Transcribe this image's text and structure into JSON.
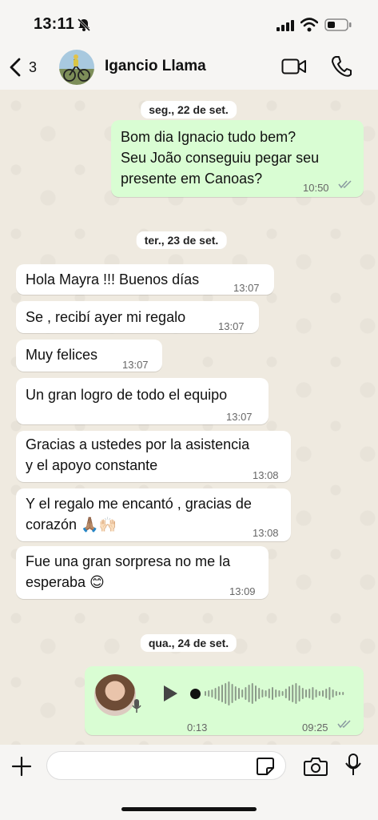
{
  "status_bar": {
    "time": "13:11"
  },
  "header": {
    "back_count": "3",
    "contact_name": "Igancio Llama"
  },
  "chat": {
    "dates": [
      "seg., 22 de set.",
      "ter., 23 de set.",
      "qua., 24 de set."
    ],
    "messages": [
      {
        "text": "Bom dia Ignacio tudo bem?\nSeu João conseguiu pegar seu\npresente em Canoas?",
        "time": "10:50"
      },
      {
        "text": "Hola Mayra !!! Buenos días",
        "time": "13:07"
      },
      {
        "text": "Se , recibí ayer mi regalo",
        "time": "13:07"
      },
      {
        "text": "Muy felices",
        "time": "13:07"
      },
      {
        "text": "Un gran logro de todo el equipo",
        "time": "13:07"
      },
      {
        "text": "Gracias a ustedes por la asistencia\ny el apoyo constante",
        "time": "13:08"
      },
      {
        "text": "Y el regalo me encantó , gracias de\ncorazón 🙏🏽🙌🏻",
        "time": "13:08"
      },
      {
        "text": "Fue una gran sorpresa no me la\nesperaba 😊",
        "time": "13:09"
      }
    ],
    "voice": {
      "duration": "0:13",
      "time": "09:25"
    }
  },
  "colors": {
    "outgoing": "#d9fdd3",
    "incoming": "#ffffff",
    "read_ticks": "#53bdeb"
  },
  "icons": [
    "bell-slash-icon",
    "signal-icon",
    "wifi-icon",
    "battery-icon",
    "chevron-left-icon",
    "video-call-icon",
    "phone-icon",
    "play-icon",
    "mic-icon",
    "plus-icon",
    "sticker-icon",
    "camera-icon",
    "double-check-icon"
  ]
}
